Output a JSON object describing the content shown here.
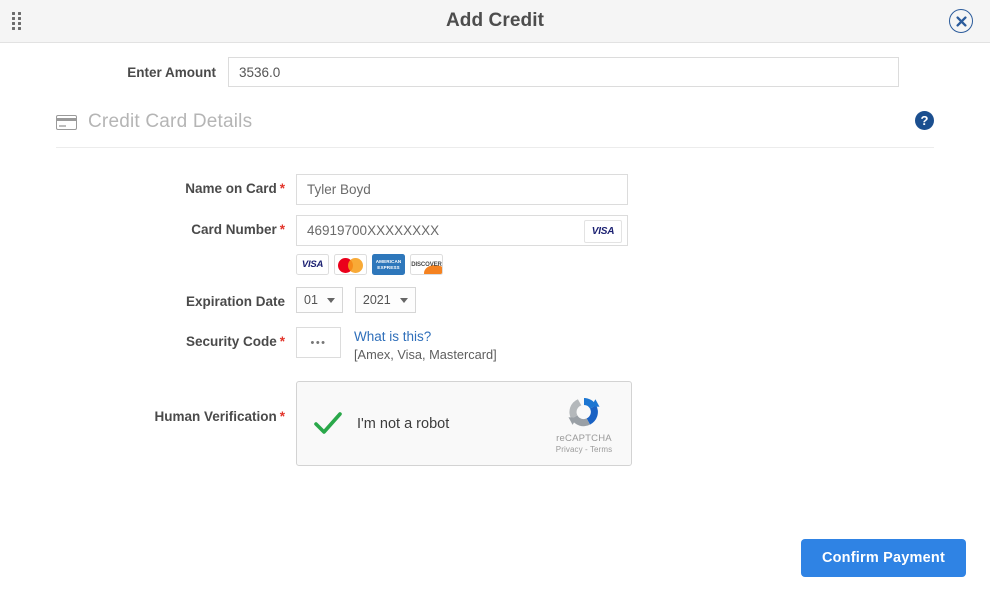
{
  "header": {
    "title": "Add Credit",
    "drag_handle_icon": "grip-dots-icon",
    "close_icon": "close-circle-icon"
  },
  "amount": {
    "label": "Enter Amount",
    "value": "3536.0",
    "placeholder": "Enter Amount"
  },
  "section": {
    "title": "Credit Card Details",
    "card_icon": "credit-card-icon",
    "help_icon": "help-circle-icon",
    "help_glyph": "?"
  },
  "fields": {
    "name_on_card": {
      "label": "Name on Card",
      "required": "*",
      "value": "Tyler Boyd",
      "placeholder": "Name on Card"
    },
    "card_number": {
      "label": "Card Number",
      "required": "*",
      "value": "46919700XXXXXXXX",
      "placeholder": "Card Number",
      "brand_badge": "VISA"
    },
    "accepted_brands": [
      {
        "name": "VISA",
        "icon": "visa-icon"
      },
      {
        "name": "mastercard",
        "icon": "mastercard-icon"
      },
      {
        "name": "AMERICAN EXPRESS",
        "icon": "amex-icon"
      },
      {
        "name": "DISCOVER",
        "icon": "discover-icon"
      }
    ],
    "expiration": {
      "label": "Expiration Date",
      "month_value": "01",
      "year_value": "2021",
      "caret_icon": "chevron-down-icon"
    },
    "security_code": {
      "label": "Security Code",
      "required": "*",
      "value": "•••",
      "link_text": "What is this?",
      "note": "[Amex, Visa, Mastercard]"
    },
    "human_verification": {
      "label": "Human Verification",
      "required": "*",
      "checkbox_label": "I'm not a robot",
      "checked": "true",
      "check_icon": "green-check-icon",
      "logo_icon": "recaptcha-logo-icon",
      "brand_name": "reCAPTCHA",
      "terms": "Privacy - Terms"
    }
  },
  "footer": {
    "confirm_label": "Confirm Payment"
  },
  "colors": {
    "accent_blue": "#2f83e4",
    "link_blue": "#2f6fba",
    "required_red": "#e2342a",
    "header_bg": "#f5f5f5",
    "check_green": "#2aa84a"
  }
}
